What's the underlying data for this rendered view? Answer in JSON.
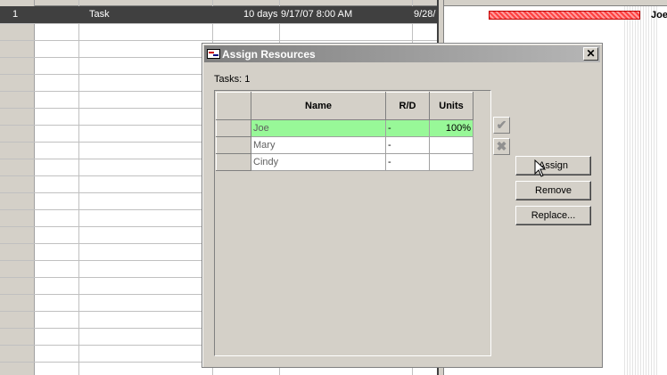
{
  "task_row": {
    "id": "1",
    "name": "Task",
    "duration": "10 days",
    "start": "9/17/07 8:00 AM",
    "finish": "9/28/"
  },
  "gantt": {
    "resource_label": "Joe",
    "bar_color": "#ff4040"
  },
  "dialog": {
    "title": "Assign Resources",
    "close_label": "✕",
    "tasks_label": "Tasks: 1",
    "columns": {
      "name": "Name",
      "rd": "R/D",
      "units": "Units"
    },
    "resources": [
      {
        "name": "Joe",
        "rd": "-",
        "units": "100%",
        "assigned": true
      },
      {
        "name": "Mary",
        "rd": "-",
        "units": "",
        "assigned": false
      },
      {
        "name": "Cindy",
        "rd": "-",
        "units": "",
        "assigned": false
      }
    ],
    "icons": {
      "accept": "checkmark-icon",
      "cancel": "x-icon"
    },
    "buttons": {
      "assign": "Assign",
      "remove": "Remove",
      "replace": "Replace..."
    },
    "assigned_color": "#98f898"
  }
}
